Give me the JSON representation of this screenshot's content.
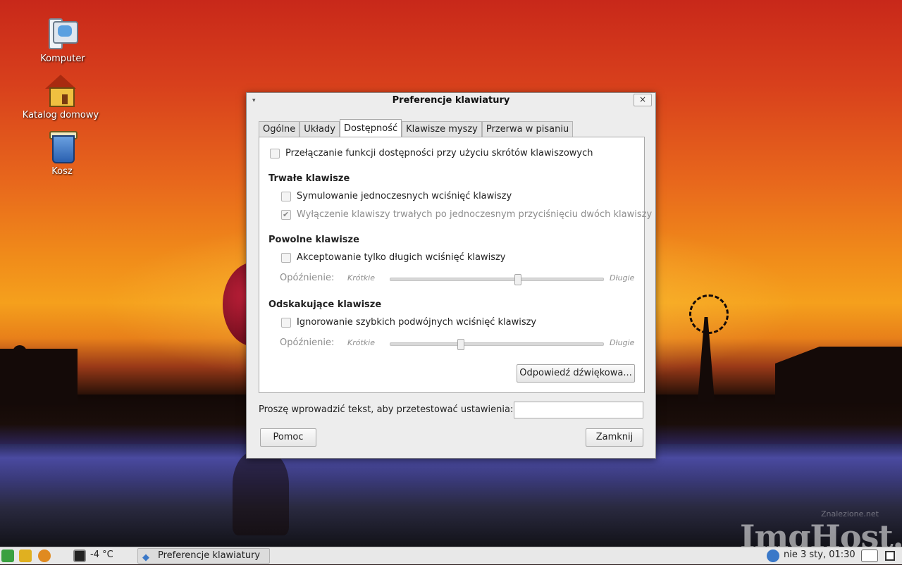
{
  "desktop": {
    "icons": [
      {
        "label": "Komputer"
      },
      {
        "label": "Katalog domowy"
      },
      {
        "label": "Kosz"
      }
    ]
  },
  "dialog": {
    "title": "Preferencje klawiatury",
    "menu_glyph": "▾",
    "close_glyph": "×",
    "tabs": [
      {
        "label": "Ogólne"
      },
      {
        "label": "Układy"
      },
      {
        "label": "Dostępność"
      },
      {
        "label": "Klawisze myszy"
      },
      {
        "label": "Przerwa w pisaniu"
      }
    ],
    "active_tab": "Dostępność",
    "toggle_shortcuts": {
      "label": "Przełączanie funkcji dostępności przy użyciu skrótów klawiszowych",
      "checked": false
    },
    "sticky": {
      "heading": "Trwałe klawisze",
      "simulate": {
        "label": "Symulowanie jednoczesnych wciśnięć klawiszy",
        "checked": false
      },
      "disable_two": {
        "label": "Wyłączenie klawiszy trwałych po jednoczesnym przyciśnięciu dwóch klawiszy",
        "checked": true,
        "enabled": false
      }
    },
    "slow": {
      "heading": "Powolne klawisze",
      "accept_long": {
        "label": "Akceptowanie tylko długich wciśnięć klawiszy",
        "checked": false
      },
      "delay": {
        "label": "Opóźnienie:",
        "min": "Krótkie",
        "max": "Długie",
        "value_fraction": 0.6
      }
    },
    "bounce": {
      "heading": "Odskakujące klawisze",
      "ignore_fast": {
        "label": "Ignorowanie szybkich podwójnych wciśnięć klawiszy",
        "checked": false
      },
      "delay": {
        "label": "Opóźnienie:",
        "min": "Krótkie",
        "max": "Długie",
        "value_fraction": 0.33
      }
    },
    "sound_button": "Odpowiedź dźwiękowa...",
    "test": {
      "label": "Proszę wprowadzić tekst, aby przetestować ustawienia:",
      "value": ""
    },
    "help_button": "Pomoc",
    "close_button": "Zamknij"
  },
  "taskbar": {
    "weather": "-4 °C",
    "task_label": "Preferencje klawiatury",
    "clock": "nie  3 sty, 01:30"
  },
  "watermark": {
    "text": "ImgHost.pl",
    "small": "Znalezione.net"
  }
}
